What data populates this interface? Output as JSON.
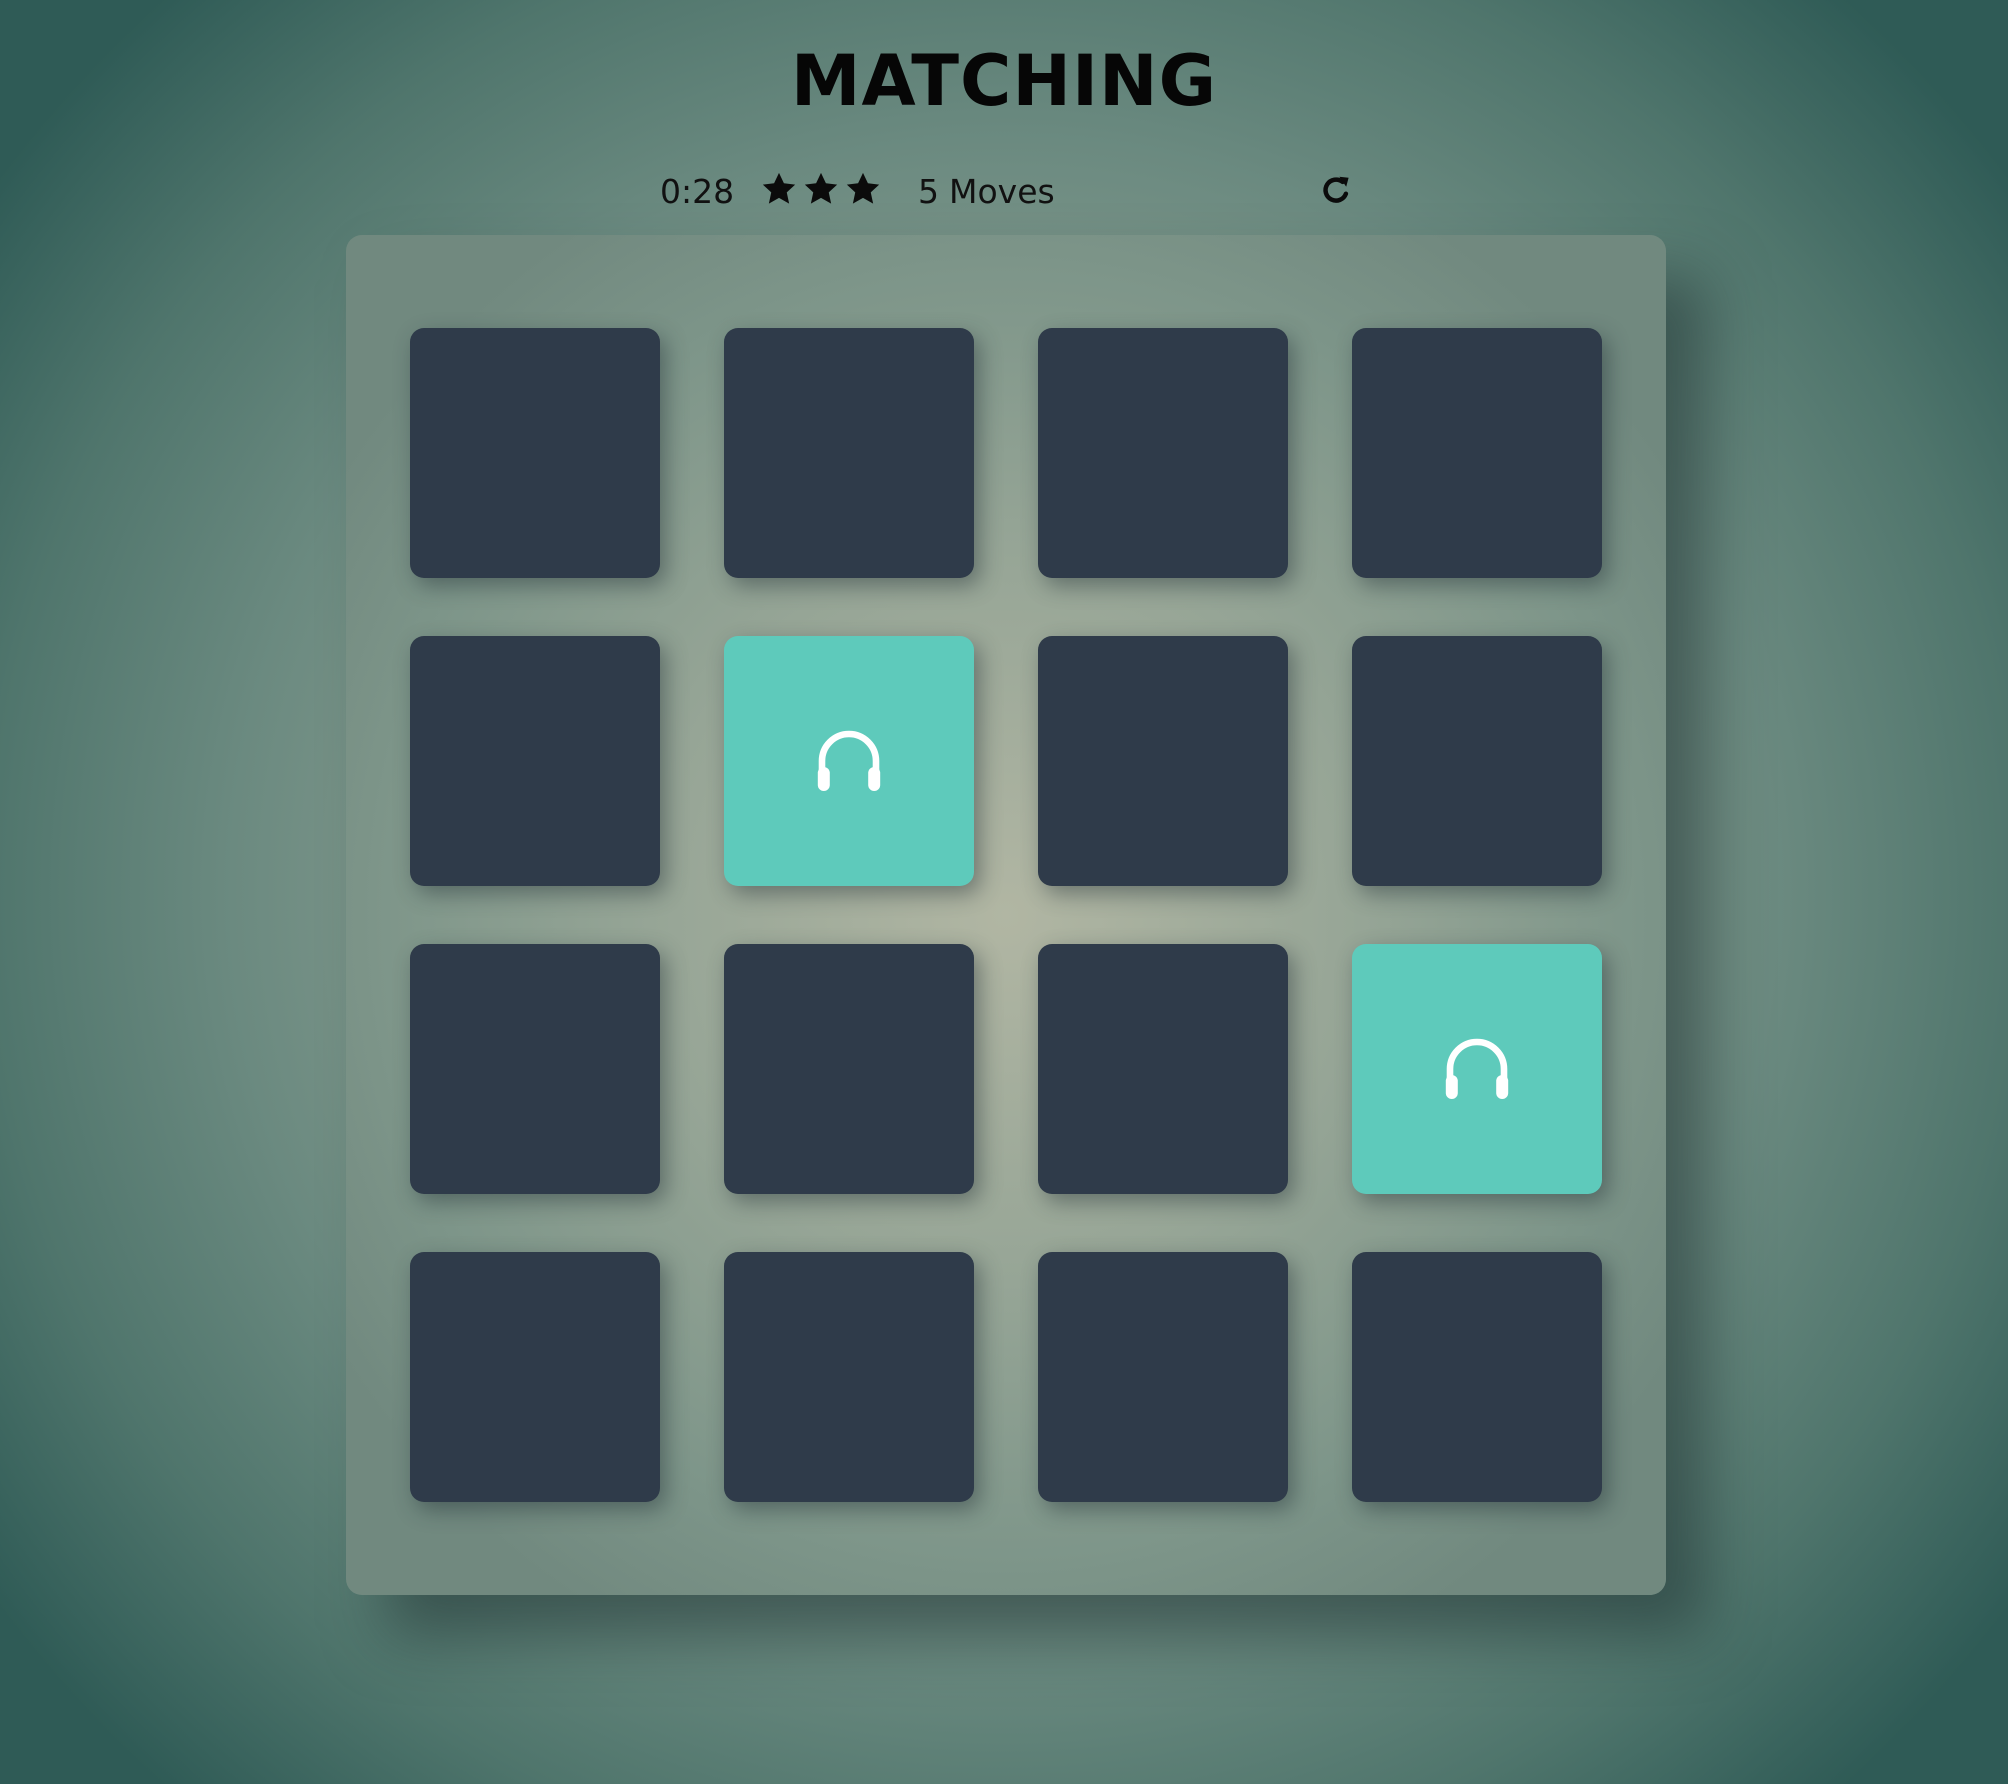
{
  "game": {
    "title": "MATCHING",
    "timer": "0:28",
    "stars": {
      "count": 3,
      "filled": 3
    },
    "moves": {
      "count": "5",
      "label": "Moves"
    },
    "restart_icon": "restart-icon"
  },
  "deck": {
    "rows": 4,
    "columns": 4,
    "cards": [
      {
        "state": "hidden"
      },
      {
        "state": "hidden"
      },
      {
        "state": "hidden"
      },
      {
        "state": "hidden"
      },
      {
        "state": "hidden"
      },
      {
        "state": "open",
        "icon": "headphones-icon"
      },
      {
        "state": "hidden"
      },
      {
        "state": "hidden"
      },
      {
        "state": "hidden"
      },
      {
        "state": "hidden"
      },
      {
        "state": "hidden"
      },
      {
        "state": "open",
        "icon": "headphones-icon"
      },
      {
        "state": "hidden"
      },
      {
        "state": "hidden"
      },
      {
        "state": "hidden"
      },
      {
        "state": "hidden"
      }
    ]
  },
  "colors": {
    "card_back": "#2f3b4a",
    "card_open": "#5ecabb",
    "icon": "#ffffff",
    "text": "#111111"
  }
}
